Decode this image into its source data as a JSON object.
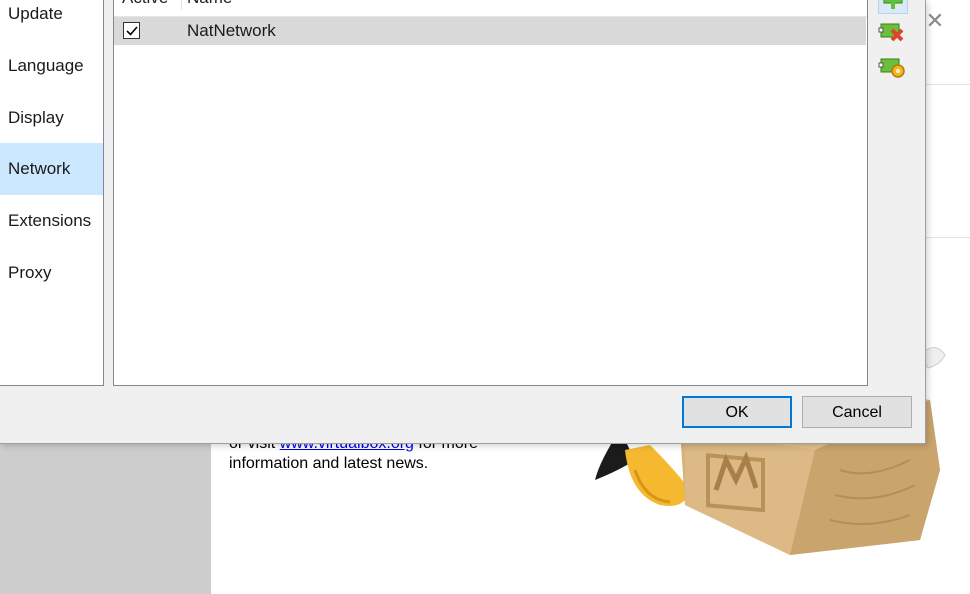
{
  "background": {
    "welcome_prefix": "or visit ",
    "welcome_link": "www.virtualbox.org",
    "welcome_suffix": " for more",
    "welcome_line2": "information and latest news.",
    "close_glyph": "✕"
  },
  "sidebar": {
    "items": [
      {
        "label": "Update"
      },
      {
        "label": "Language"
      },
      {
        "label": "Display"
      },
      {
        "label": "Network",
        "selected": true
      },
      {
        "label": "Extensions"
      },
      {
        "label": "Proxy"
      }
    ]
  },
  "nat_table": {
    "columns": [
      "Active",
      "Name"
    ],
    "rows": [
      {
        "active": true,
        "name": "NatNetwork"
      }
    ]
  },
  "toolbar": {
    "icons": [
      "add-nat-network-icon",
      "remove-nat-network-icon",
      "edit-nat-network-icon"
    ]
  },
  "buttons": {
    "ok": "OK",
    "cancel": "Cancel"
  },
  "colors": {
    "selection": "#cce8ff",
    "row_highlight": "#d9d9d9",
    "default_button_border": "#0078d7",
    "link": "#0000ee"
  }
}
